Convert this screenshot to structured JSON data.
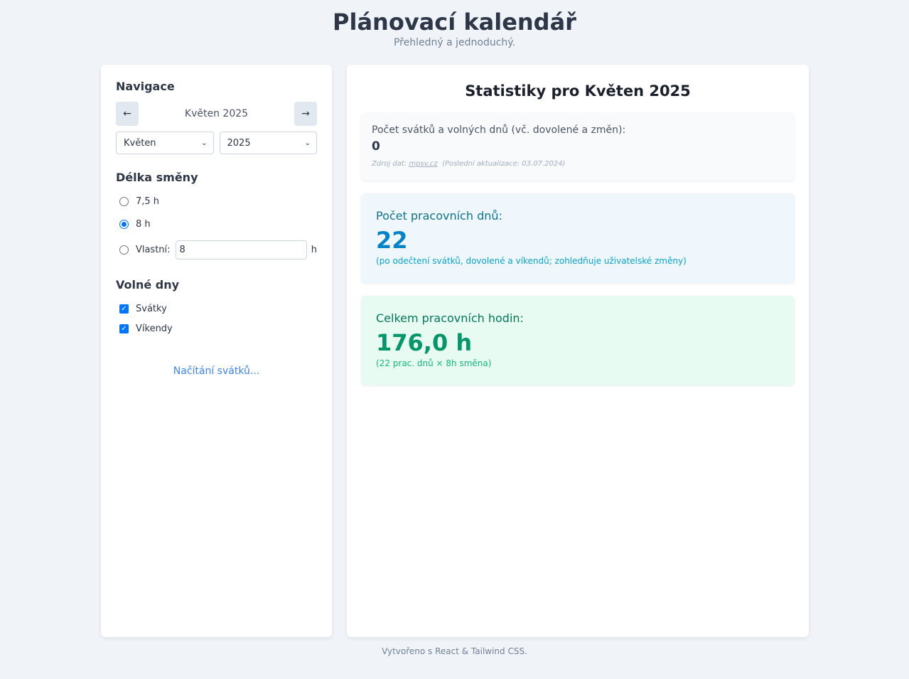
{
  "header": {
    "title": "Plánovací kalendář",
    "subtitle": "Přehledný a jednoduchý."
  },
  "navigation": {
    "title": "Navigace",
    "prev_icon": "arrow-left-icon",
    "prev_label": "←",
    "current_label": "Květen 2025",
    "next_icon": "arrow-right-icon",
    "next_label": "→",
    "month_select": "Květen",
    "year_select": "2025",
    "select_caret": "⌄"
  },
  "shift": {
    "title": "Délka směny",
    "options": [
      {
        "label": "7,5 h",
        "checked": false
      },
      {
        "label": "8 h",
        "checked": true
      }
    ],
    "custom_label": "Vlastní:",
    "custom_value": "8",
    "custom_unit": "h"
  },
  "days_off": {
    "title": "Volné dny",
    "items": [
      {
        "label": "Svátky",
        "checked": true
      },
      {
        "label": "Víkendy",
        "checked": true
      }
    ],
    "check_mark": "✓"
  },
  "loading_text": "Načítání svátků...",
  "stats": {
    "title": "Statistiky pro Květen 2025",
    "holidays": {
      "label": "Počet svátků a volných dnů (vč. dovolené a změn):",
      "value": "0",
      "source_prefix": "Zdroj dat:",
      "source_link": "mpsv.cz",
      "source_updated": "(Poslední aktualizace: 03.07.2024)"
    },
    "working_days": {
      "label": "Počet pracovních dnů:",
      "value": "22",
      "note": "(po odečtení svátků, dovolené a víkendů; zohledňuje uživatelské změny)"
    },
    "working_hours": {
      "label": "Celkem pracovních hodin:",
      "value": "176,0 h",
      "note": "(22 prac. dnů × 8h směna)"
    }
  },
  "footer": "Vytvořeno s React & Tailwind CSS.",
  "colors": {
    "background": "#f0f4f8",
    "accent_blue": "#0284c7",
    "accent_green": "#059669",
    "radio_checked": "#0075ff"
  }
}
